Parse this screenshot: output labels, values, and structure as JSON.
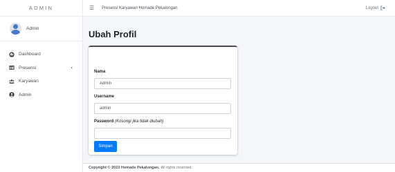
{
  "brand": "ADMIN",
  "user_panel": {
    "name": "Admin"
  },
  "sidebar": {
    "items": [
      {
        "label": "Dashboard",
        "icon": "dashboard-icon"
      },
      {
        "label": "Presensi",
        "icon": "table-icon",
        "caret": "‹"
      },
      {
        "label": "Karyawan",
        "icon": "users-icon"
      },
      {
        "label": "Admin",
        "icon": "user-circle-icon"
      }
    ]
  },
  "header": {
    "title": "Presensi Karyawan Homade Pekalongan",
    "logout": "Logout",
    "menu_icon": "☰"
  },
  "page": {
    "title": "Ubah Profil"
  },
  "form": {
    "nama_label": "Nama",
    "nama_value": "Admin",
    "username_label": "Username",
    "username_value": "admin",
    "password_label": "Password",
    "password_hint": "(Kosongi jika tidak diubah)",
    "password_value": "",
    "submit_label": "Simpan"
  },
  "footer": {
    "copyright": "Copyright © 2023 Homade Pekalongan.",
    "rights": "All rights reserved."
  },
  "colors": {
    "accent": "#007bff",
    "avatar": "#4a78c8",
    "content_bg": "#f4f6f9"
  }
}
